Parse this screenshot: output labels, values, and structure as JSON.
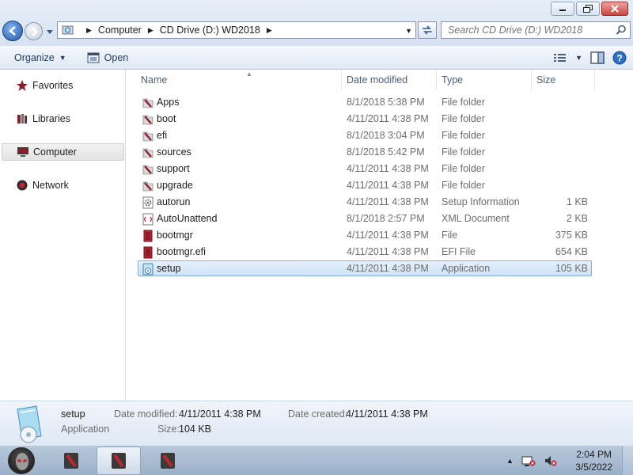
{
  "window": {
    "controls": {
      "minimize": "minimize-icon",
      "maximize": "maximize-icon",
      "close": "close-icon"
    }
  },
  "address": {
    "segments": [
      "Computer",
      "CD Drive (D:) WD2018"
    ],
    "search_placeholder": "Search CD Drive (D:) WD2018"
  },
  "toolbar": {
    "organize_label": "Organize",
    "open_label": "Open"
  },
  "sidebar": {
    "items": [
      {
        "label": "Favorites",
        "icon": "star-icon"
      },
      {
        "label": "Libraries",
        "icon": "library-icon"
      },
      {
        "label": "Computer",
        "icon": "computer-icon"
      },
      {
        "label": "Network",
        "icon": "network-icon"
      }
    ],
    "selected": "Computer"
  },
  "columns": {
    "name": "Name",
    "date": "Date modified",
    "type": "Type",
    "size": "Size"
  },
  "files": [
    {
      "name": "Apps",
      "date": "8/1/2018 5:38 PM",
      "type": "File folder",
      "size": "",
      "icon": "folder-icon"
    },
    {
      "name": "boot",
      "date": "4/11/2011 4:38 PM",
      "type": "File folder",
      "size": "",
      "icon": "folder-icon"
    },
    {
      "name": "efi",
      "date": "8/1/2018 3:04 PM",
      "type": "File folder",
      "size": "",
      "icon": "folder-icon"
    },
    {
      "name": "sources",
      "date": "8/1/2018 5:42 PM",
      "type": "File folder",
      "size": "",
      "icon": "folder-icon"
    },
    {
      "name": "support",
      "date": "4/11/2011 4:38 PM",
      "type": "File folder",
      "size": "",
      "icon": "folder-icon"
    },
    {
      "name": "upgrade",
      "date": "4/11/2011 4:38 PM",
      "type": "File folder",
      "size": "",
      "icon": "folder-icon"
    },
    {
      "name": "autorun",
      "date": "4/11/2011 4:38 PM",
      "type": "Setup Information",
      "size": "1 KB",
      "icon": "settings-file-icon"
    },
    {
      "name": "AutoUnattend",
      "date": "8/1/2018 2:57 PM",
      "type": "XML Document",
      "size": "2 KB",
      "icon": "xml-file-icon"
    },
    {
      "name": "bootmgr",
      "date": "4/11/2011 4:38 PM",
      "type": "File",
      "size": "375 KB",
      "icon": "file-icon"
    },
    {
      "name": "bootmgr.efi",
      "date": "4/11/2011 4:38 PM",
      "type": "EFI File",
      "size": "654 KB",
      "icon": "file-icon"
    },
    {
      "name": "setup",
      "date": "4/11/2011 4:38 PM",
      "type": "Application",
      "size": "105 KB",
      "icon": "setup-app-icon"
    }
  ],
  "selected_file": "setup",
  "details": {
    "name": "setup",
    "kind": "Application",
    "date_modified_label": "Date modified:",
    "date_modified": "4/11/2011 4:38 PM",
    "date_created_label": "Date created:",
    "date_created": "4/11/2011 4:38 PM",
    "size_label": "Size:",
    "size": "104 KB"
  },
  "taskbar": {
    "time": "2:04 PM",
    "date": "3/5/2022"
  },
  "colors": {
    "selection": "#cde3f8",
    "selection_border": "#84acdd",
    "folder_icon": "#8b1e2a"
  }
}
